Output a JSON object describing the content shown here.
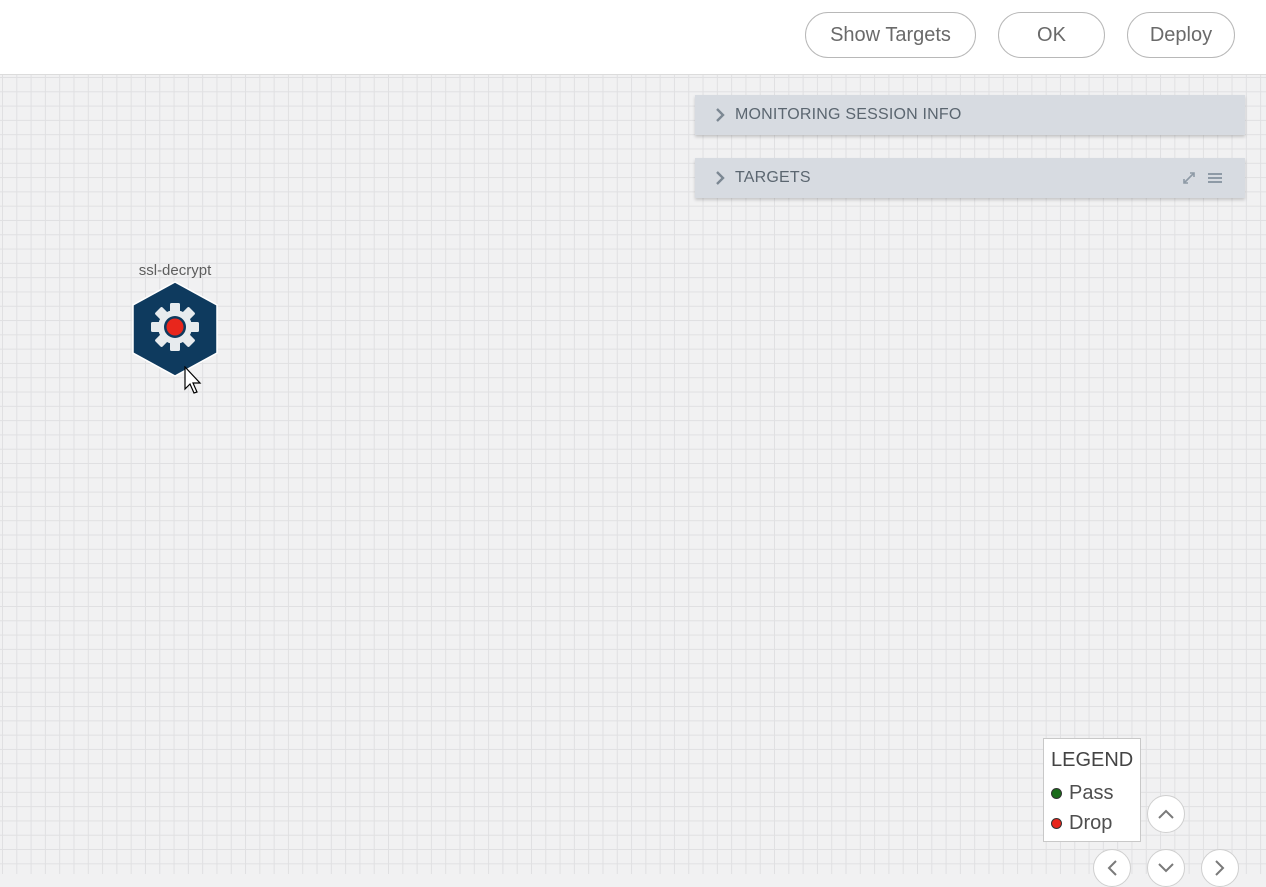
{
  "toolbar": {
    "show_targets_label": "Show Targets",
    "ok_label": "OK",
    "deploy_label": "Deploy"
  },
  "panels": {
    "monitoring_session_info": "MONITORING SESSION INFO",
    "targets": "TARGETS"
  },
  "node": {
    "label": "ssl-decrypt",
    "status_color": "#e8261c",
    "hex_color": "#0e3a5e"
  },
  "legend": {
    "title": "LEGEND",
    "items": [
      {
        "label": "Pass",
        "color": "#1a6b1a"
      },
      {
        "label": "Drop",
        "color": "#e8261c"
      }
    ]
  },
  "navigation": {
    "icons": [
      "chevron-up-icon",
      "chevron-left-icon",
      "chevron-down-icon",
      "chevron-right-icon"
    ]
  }
}
